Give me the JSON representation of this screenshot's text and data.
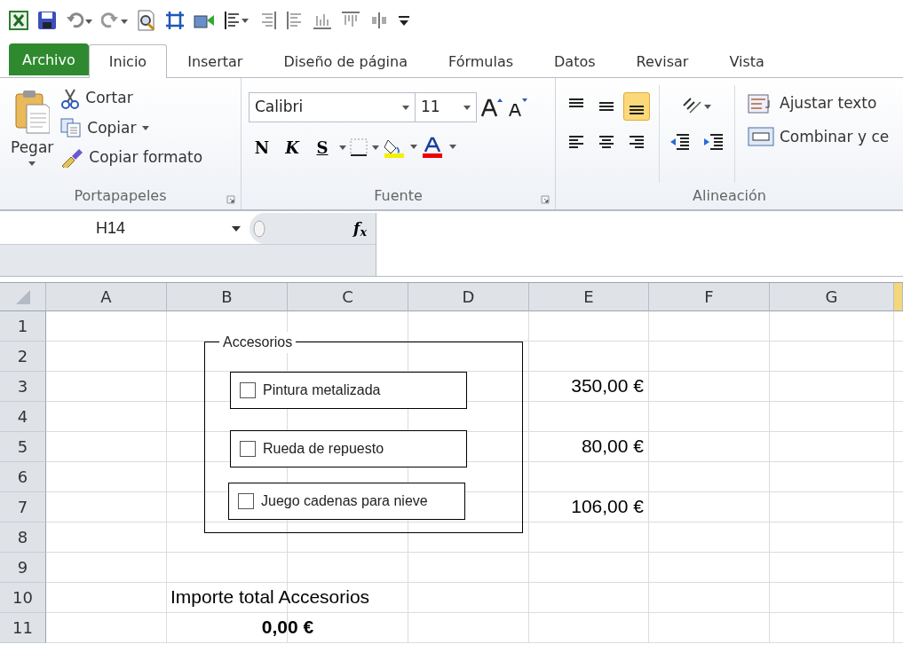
{
  "ribbon_tabs": [
    {
      "label": "Archivo",
      "kind": "file",
      "selected": false
    },
    {
      "label": "Inicio",
      "kind": "tab",
      "selected": true
    },
    {
      "label": "Insertar",
      "kind": "tab",
      "selected": false
    },
    {
      "label": "Diseño de página",
      "kind": "tab",
      "selected": false
    },
    {
      "label": "Fórmulas",
      "kind": "tab",
      "selected": false
    },
    {
      "label": "Datos",
      "kind": "tab",
      "selected": false
    },
    {
      "label": "Revisar",
      "kind": "tab",
      "selected": false
    },
    {
      "label": "Vista",
      "kind": "tab",
      "selected": false
    }
  ],
  "clipboard_group": {
    "paste": "Pegar",
    "cut": "Cortar",
    "copy": "Copiar",
    "format_painter": "Copiar formato",
    "label": "Portapapeles"
  },
  "font_group": {
    "font_name": "Calibri",
    "font_size": "11",
    "bold": "N",
    "italic": "K",
    "underline": "S",
    "label": "Fuente"
  },
  "alignment_group": {
    "vertical_align": [
      {
        "kind": "top",
        "selected": false
      },
      {
        "kind": "middle",
        "selected": false
      },
      {
        "kind": "bottom",
        "selected": true
      }
    ],
    "wrap_text": "Ajustar texto",
    "merge": "Combinar y ce",
    "label": "Alineación"
  },
  "formula_bar": {
    "name_box": "H14",
    "function_label": "f$_{x}$"
  },
  "sheet": {
    "columns": [
      "A",
      "B",
      "C",
      "D",
      "E",
      "F",
      "G"
    ],
    "rows": [
      {
        "label": "1",
        "cells": []
      },
      {
        "label": "2",
        "cells": []
      },
      {
        "label": "3",
        "kind": "amount",
        "cells": [
          "",
          "",
          "",
          "",
          "350,00 €"
        ]
      },
      {
        "label": "4",
        "cells": []
      },
      {
        "label": "5",
        "kind": "amount",
        "cells": [
          "",
          "",
          "",
          "",
          "80,00 €"
        ]
      },
      {
        "label": "6",
        "cells": []
      },
      {
        "label": "7",
        "kind": "amount",
        "cells": [
          "",
          "",
          "",
          "",
          "106,00 €"
        ]
      },
      {
        "label": "8",
        "cells": []
      },
      {
        "label": "9",
        "cells": []
      },
      {
        "label": "10",
        "kind": "label",
        "cells": [
          "",
          "Importe total Accesorios"
        ]
      },
      {
        "label": "11",
        "kind": "total",
        "cells": [
          "",
          "0,00 €"
        ]
      }
    ]
  },
  "group_box": {
    "title": "Accesorios",
    "options": [
      {
        "label": "Pintura metalizada",
        "checked": false
      },
      {
        "label": "Rueda de repuesto",
        "checked": false
      },
      {
        "label": "Juego cadenas para nieve",
        "checked": false
      }
    ]
  }
}
